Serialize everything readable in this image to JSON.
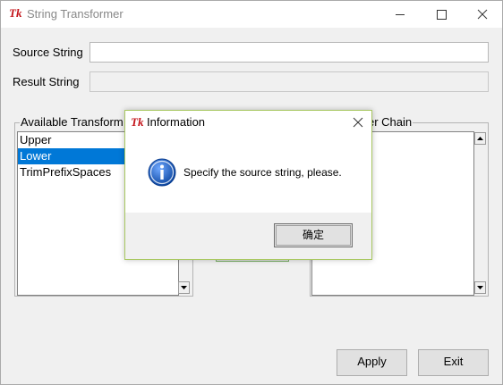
{
  "window": {
    "title": "String Transformer",
    "logo_text": "Tk"
  },
  "form": {
    "source_label": "Source String",
    "source_value": "",
    "result_label": "Result String",
    "result_value": ""
  },
  "available": {
    "group_title": "Available Transform",
    "items": [
      {
        "label": "Upper",
        "selected": false
      },
      {
        "label": "Lower",
        "selected": true
      },
      {
        "label": "TrimPrefixSpaces",
        "selected": false
      }
    ]
  },
  "chain": {
    "group_title": "er Chain",
    "items": []
  },
  "buttons": {
    "apply_label": "Apply",
    "exit_label": "Exit"
  },
  "dialog": {
    "title": "Information",
    "message": "Specify the source string, please.",
    "ok_label": "确定"
  },
  "colors": {
    "selection": "#0078d7",
    "dialog_border": "#a9c862",
    "info_icon": "#1565c0"
  },
  "icons": [
    "tk-logo-icon",
    "minimize-icon",
    "maximize-icon",
    "close-icon",
    "info-icon",
    "scroll-up-icon",
    "scroll-down-icon"
  ]
}
